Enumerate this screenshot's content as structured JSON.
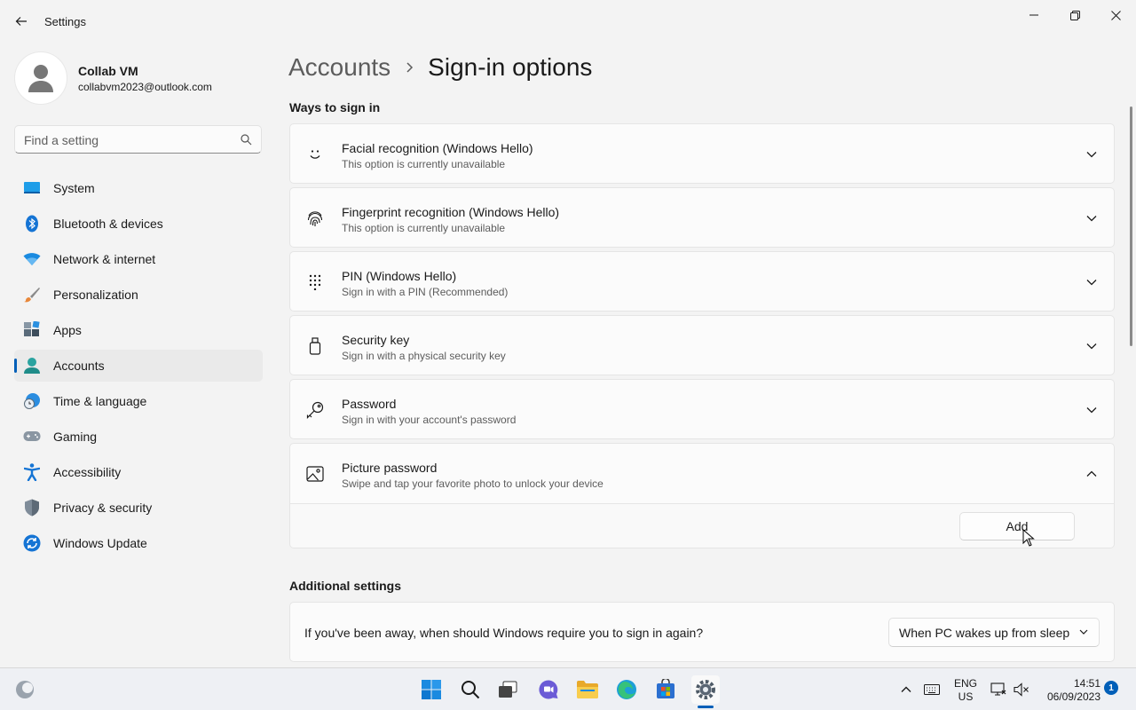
{
  "window": {
    "title": "Settings",
    "controls": [
      "minimize",
      "maximize",
      "close"
    ]
  },
  "profile": {
    "name": "Collab VM",
    "email": "collabvm2023@outlook.com"
  },
  "search": {
    "placeholder": "Find a setting"
  },
  "sidebar": {
    "items": [
      {
        "label": "System",
        "icon": "system-icon"
      },
      {
        "label": "Bluetooth & devices",
        "icon": "bluetooth-icon"
      },
      {
        "label": "Network & internet",
        "icon": "wifi-icon"
      },
      {
        "label": "Personalization",
        "icon": "brush-icon"
      },
      {
        "label": "Apps",
        "icon": "apps-icon"
      },
      {
        "label": "Accounts",
        "icon": "accounts-icon",
        "active": true
      },
      {
        "label": "Time & language",
        "icon": "globe-clock-icon"
      },
      {
        "label": "Gaming",
        "icon": "gamepad-icon"
      },
      {
        "label": "Accessibility",
        "icon": "accessibility-icon"
      },
      {
        "label": "Privacy & security",
        "icon": "shield-icon"
      },
      {
        "label": "Windows Update",
        "icon": "update-icon"
      }
    ]
  },
  "breadcrumb": {
    "parent": "Accounts",
    "current": "Sign-in options"
  },
  "sections": {
    "ways_title": "Ways to sign in",
    "additional_title": "Additional settings"
  },
  "sign_in_options": [
    {
      "title": "Facial recognition (Windows Hello)",
      "subtitle": "This option is currently unavailable",
      "icon": "face-icon",
      "expanded": false
    },
    {
      "title": "Fingerprint recognition (Windows Hello)",
      "subtitle": "This option is currently unavailable",
      "icon": "fingerprint-icon",
      "expanded": false
    },
    {
      "title": "PIN (Windows Hello)",
      "subtitle": "Sign in with a PIN (Recommended)",
      "icon": "pin-keypad-icon",
      "expanded": false
    },
    {
      "title": "Security key",
      "subtitle": "Sign in with a physical security key",
      "icon": "usb-key-icon",
      "expanded": false
    },
    {
      "title": "Password",
      "subtitle": "Sign in with your account's password",
      "icon": "key-icon",
      "expanded": false
    },
    {
      "title": "Picture password",
      "subtitle": "Swipe and tap your favorite photo to unlock your device",
      "icon": "picture-icon",
      "expanded": true,
      "action_label": "Add"
    }
  ],
  "additional": {
    "question": "If you've been away, when should Windows require you to sign in again?",
    "dropdown_value": "When PC wakes up from sleep"
  },
  "taskbar": {
    "apps": [
      "widgets-icon",
      "start-icon",
      "search-icon",
      "task-view-icon",
      "chat-icon",
      "file-explorer-icon",
      "edge-icon",
      "store-icon",
      "settings-icon"
    ],
    "language_line1": "ENG",
    "language_line2": "US",
    "time": "14:51",
    "date": "06/09/2023",
    "notification_count": "1"
  },
  "colors": {
    "accent": "#005fb8",
    "background": "#f3f3f3",
    "card": "#fbfbfb"
  }
}
